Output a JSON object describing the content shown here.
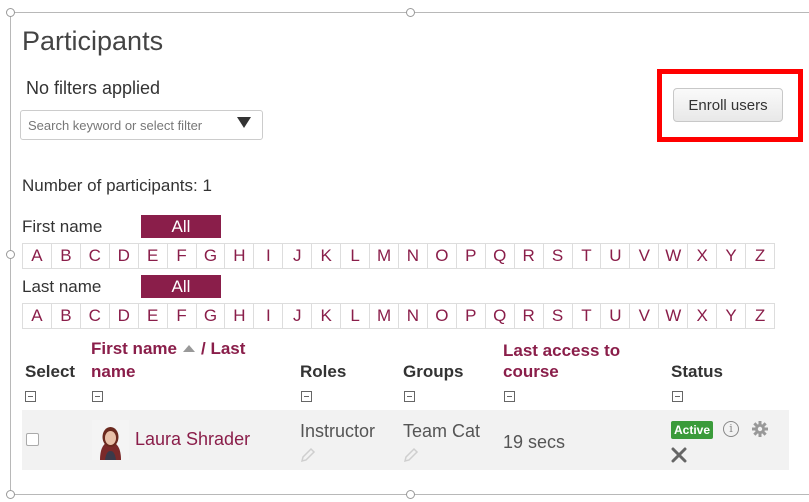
{
  "page": {
    "title": "Participants",
    "filter_status": "No filters applied",
    "search_placeholder": "Search keyword or select filter",
    "enroll_button": "Enroll users",
    "participant_count": "Number of participants: 1"
  },
  "initials_bar": {
    "first_name_label": "First name",
    "last_name_label": "Last name",
    "all_label": "All",
    "letters": [
      "A",
      "B",
      "C",
      "D",
      "E",
      "F",
      "G",
      "H",
      "I",
      "J",
      "K",
      "L",
      "M",
      "N",
      "O",
      "P",
      "Q",
      "R",
      "S",
      "T",
      "U",
      "V",
      "W",
      "X",
      "Y",
      "Z"
    ]
  },
  "table": {
    "headers": {
      "select": "Select",
      "first_name": "First name",
      "separator": "/",
      "last": "Last",
      "name": "name",
      "roles": "Roles",
      "groups": "Groups",
      "last_access_line1": "Last access to",
      "last_access_line2": "course",
      "status": "Status"
    },
    "rows": [
      {
        "name": "Laura Shrader",
        "role": "Instructor",
        "group": "Team Cat",
        "last_access": "19 secs",
        "status": "Active"
      }
    ]
  },
  "colors": {
    "accent": "#8a1e4a",
    "highlight": "#ff0000",
    "active_badge": "#3a9b3a"
  },
  "icons": [
    "search-caret-icon",
    "collapse-icon",
    "sort-up-icon",
    "pencil-icon",
    "info-icon",
    "gear-icon",
    "close-icon"
  ]
}
